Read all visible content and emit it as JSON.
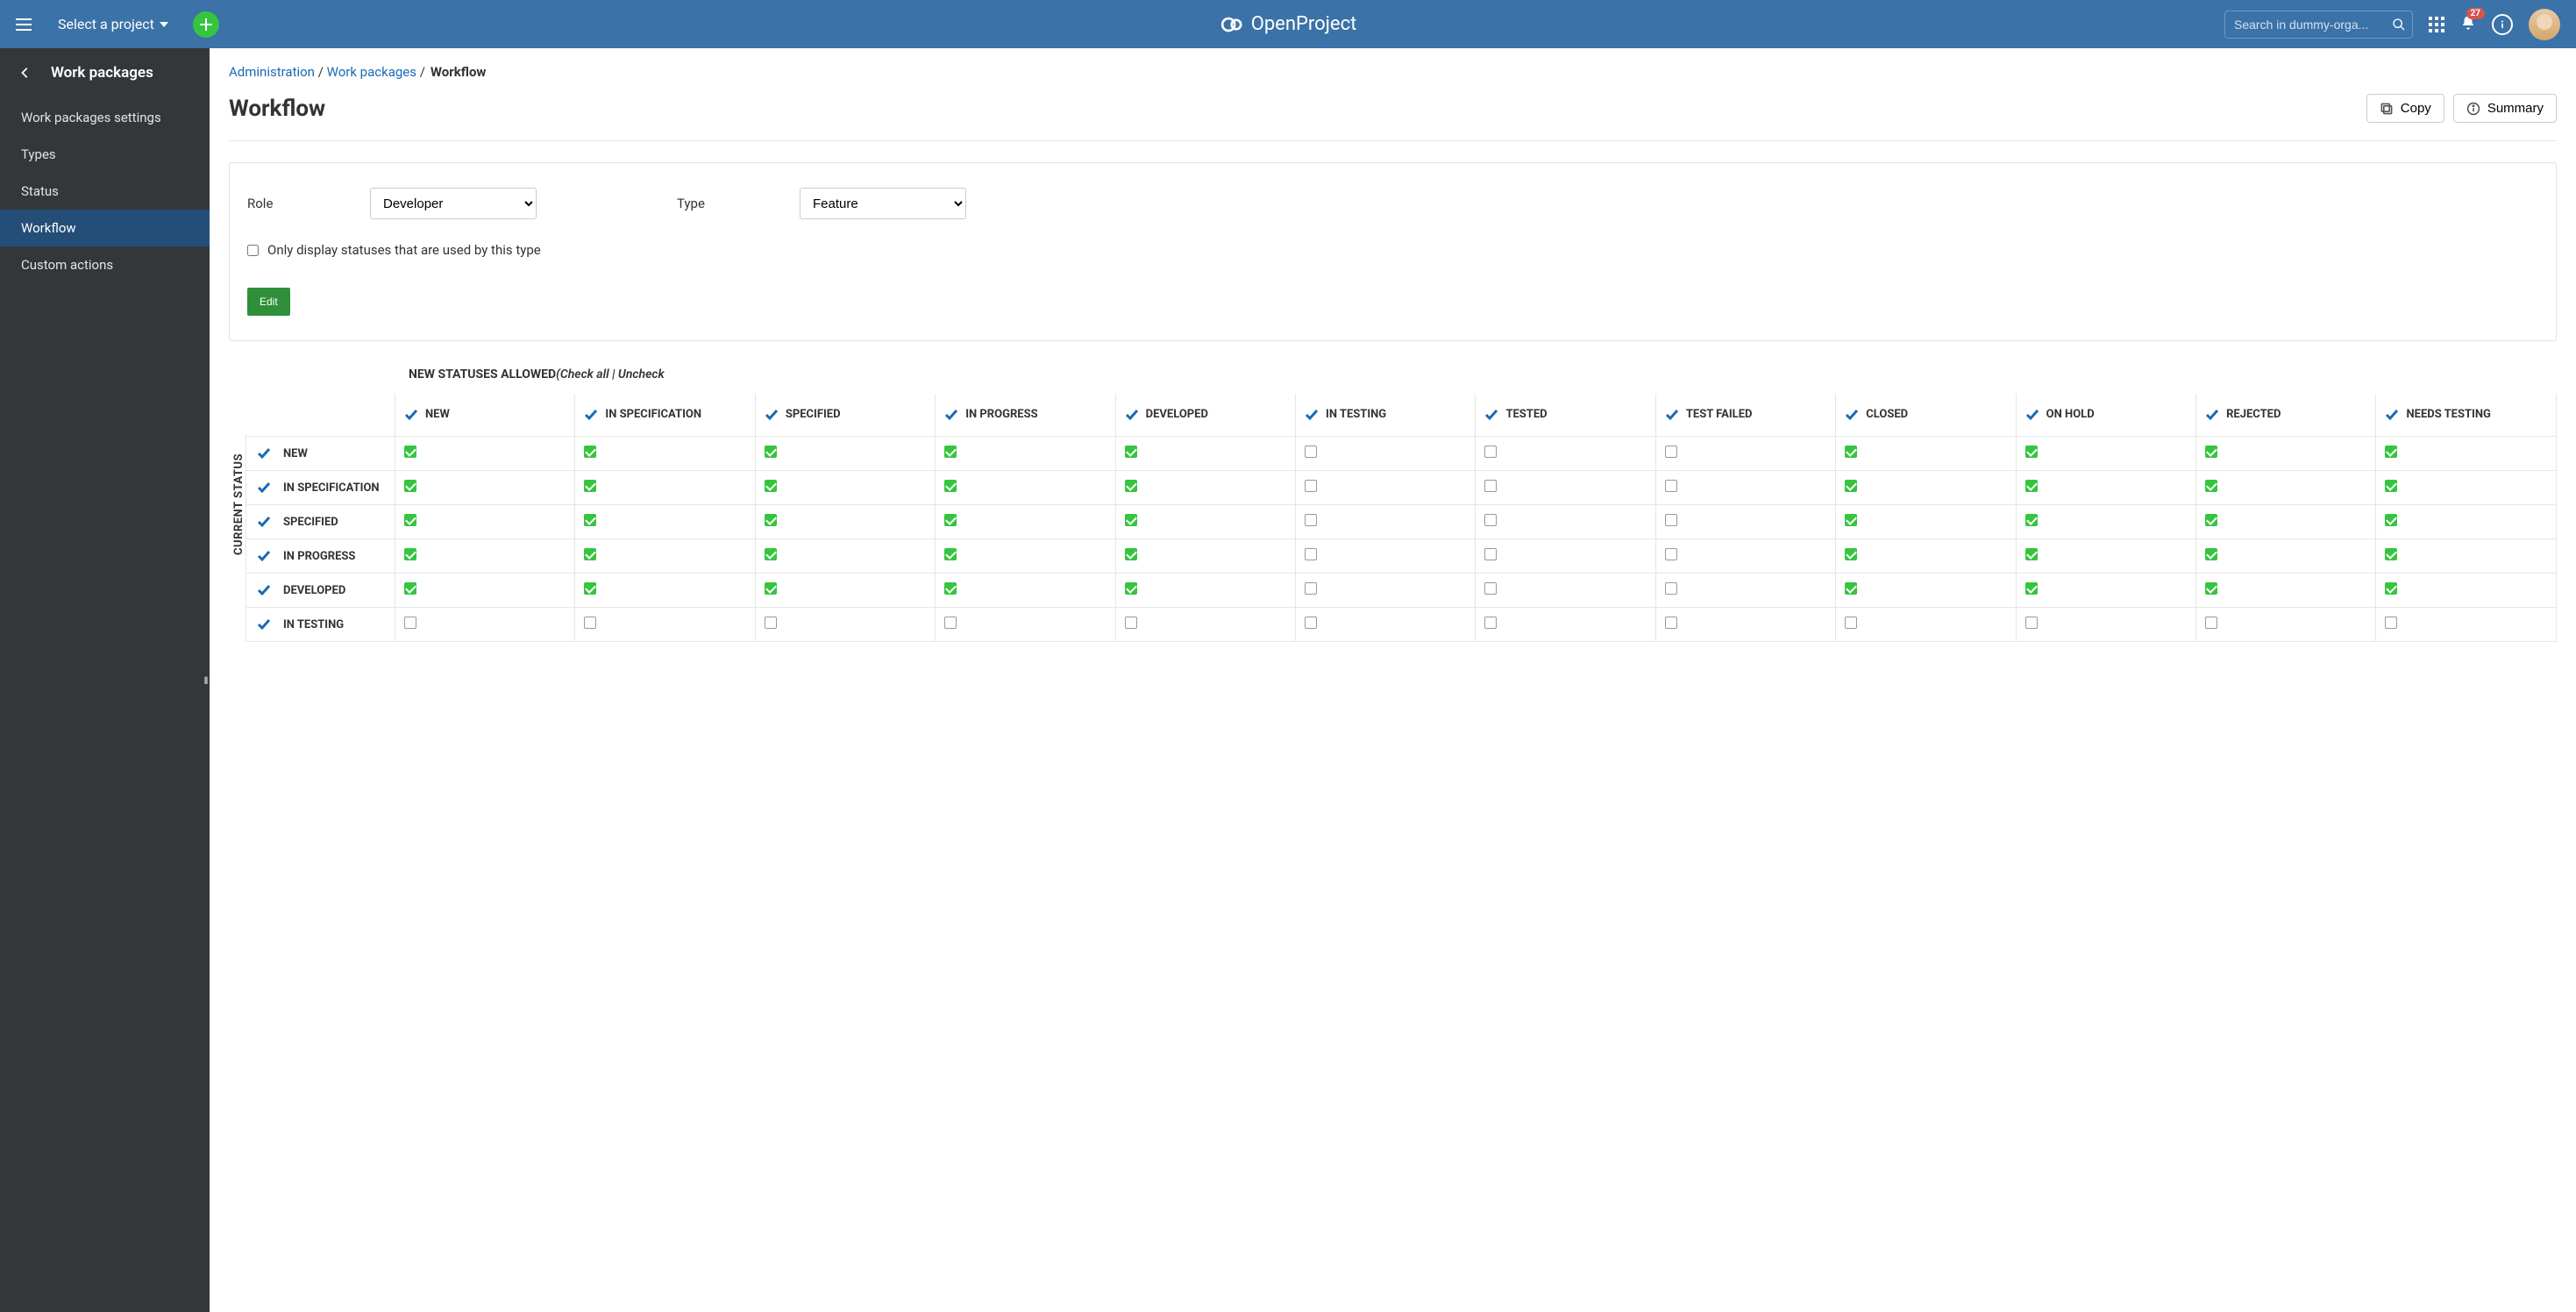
{
  "colors": {
    "primary": "#3b72a7",
    "sidebar": "#333739",
    "accent": "#35c53f",
    "link": "#1b69b6"
  },
  "topbar": {
    "project_selector": "Select a project",
    "search_placeholder": "Search in dummy-orga...",
    "brand": "OpenProject",
    "notification_count": "27"
  },
  "sidebar": {
    "back_label": "Work packages",
    "items": [
      {
        "label": "Work packages settings",
        "active": false
      },
      {
        "label": "Types",
        "active": false
      },
      {
        "label": "Status",
        "active": false
      },
      {
        "label": "Workflow",
        "active": true
      },
      {
        "label": "Custom actions",
        "active": false
      }
    ]
  },
  "breadcrumb": {
    "items": [
      "Administration",
      "Work packages"
    ],
    "current": "Workflow"
  },
  "page": {
    "title": "Workflow",
    "actions": {
      "copy": "Copy",
      "summary": "Summary"
    }
  },
  "form": {
    "role_label": "Role",
    "role_value": "Developer",
    "type_label": "Type",
    "type_value": "Feature",
    "filter_label": "Only display statuses that are used by this type",
    "filter_checked": false,
    "edit_button": "Edit"
  },
  "matrix": {
    "top_caption_bold": "NEW STATUSES ALLOWED",
    "top_caption_extra": "(Check all | Uncheck",
    "vertical_label": "CURRENT STATUS",
    "columns": [
      "NEW",
      "IN SPECIFICATION",
      "SPECIFIED",
      "IN PROGRESS",
      "DEVELOPED",
      "IN TESTING",
      "TESTED",
      "TEST FAILED",
      "CLOSED",
      "ON HOLD",
      "REJECTED",
      "NEEDS TESTING"
    ],
    "rows": [
      {
        "label": "NEW",
        "cells": [
          true,
          true,
          true,
          true,
          true,
          false,
          false,
          false,
          true,
          true,
          true,
          true
        ]
      },
      {
        "label": "IN SPECIFICATION",
        "cells": [
          true,
          true,
          true,
          true,
          true,
          false,
          false,
          false,
          true,
          true,
          true,
          true
        ]
      },
      {
        "label": "SPECIFIED",
        "cells": [
          true,
          true,
          true,
          true,
          true,
          false,
          false,
          false,
          true,
          true,
          true,
          true
        ]
      },
      {
        "label": "IN PROGRESS",
        "cells": [
          true,
          true,
          true,
          true,
          true,
          false,
          false,
          false,
          true,
          true,
          true,
          true
        ]
      },
      {
        "label": "DEVELOPED",
        "cells": [
          true,
          true,
          true,
          true,
          true,
          false,
          false,
          false,
          true,
          true,
          true,
          true
        ]
      },
      {
        "label": "IN TESTING",
        "cells": [
          false,
          false,
          false,
          false,
          false,
          false,
          false,
          false,
          false,
          false,
          false,
          false
        ]
      }
    ]
  }
}
